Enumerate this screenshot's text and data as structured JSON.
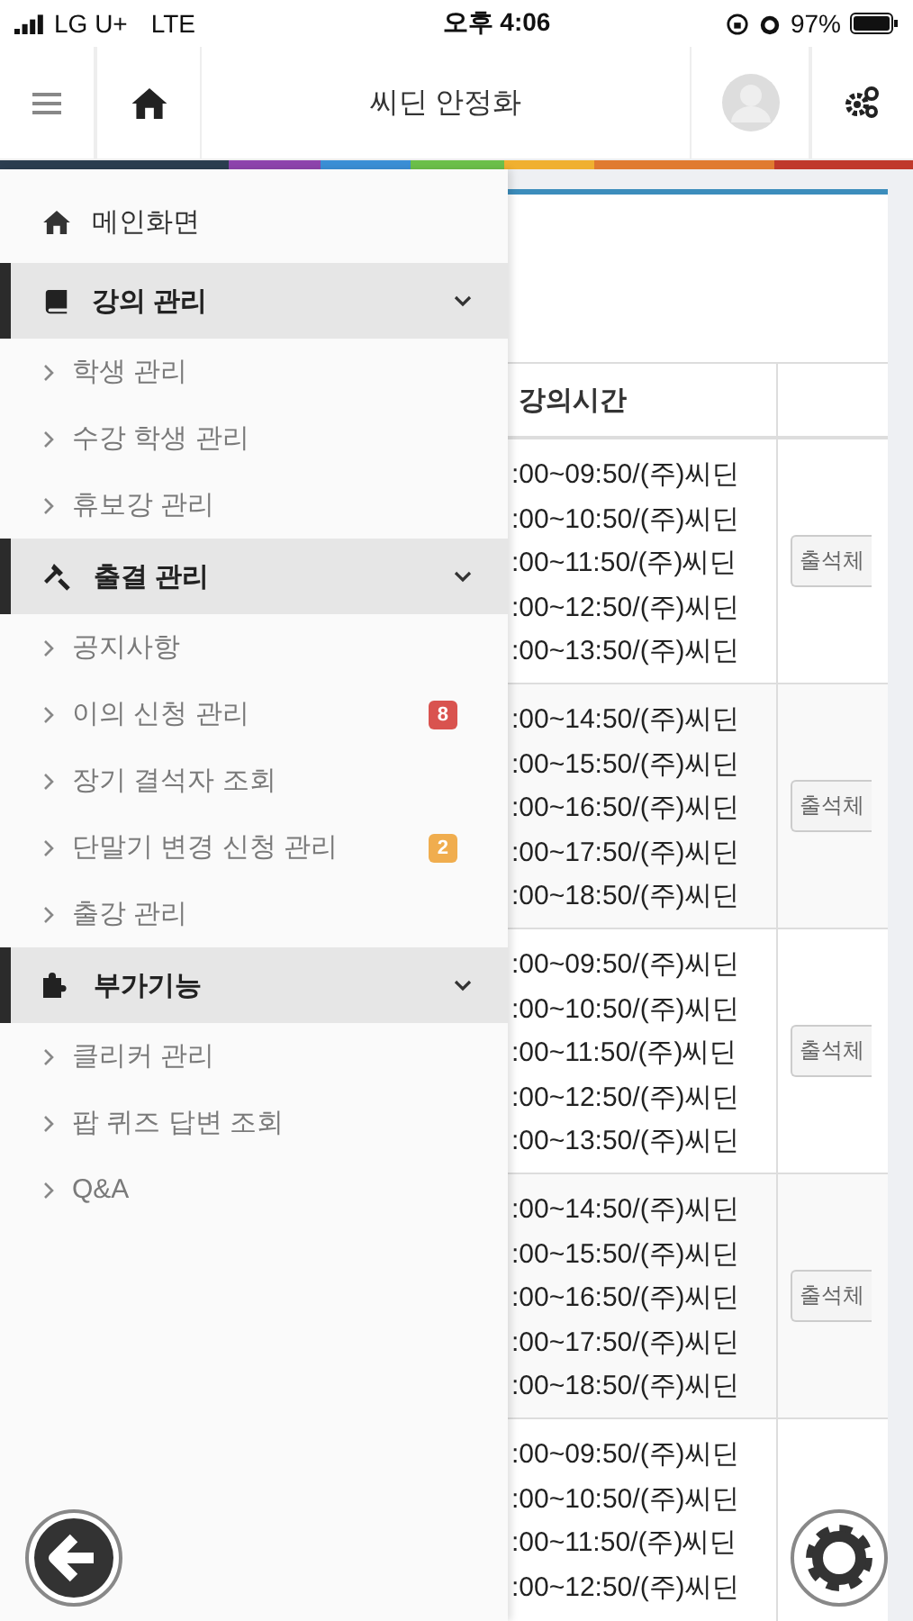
{
  "status_bar": {
    "carrier": "LG U+",
    "network": "LTE",
    "time": "오후 4:06",
    "battery": "97%"
  },
  "header": {
    "title": "씨딘 안정화"
  },
  "menu": [
    {
      "kind": "link",
      "label": "메인화면"
    },
    {
      "kind": "section",
      "label": "강의 관리",
      "expanded": true,
      "children": [
        {
          "label": "학생 관리"
        },
        {
          "label": "수강 학생 관리"
        },
        {
          "label": "휴보강 관리"
        }
      ]
    },
    {
      "kind": "section",
      "label": "출결 관리",
      "expanded": true,
      "children": [
        {
          "label": "공지사항"
        },
        {
          "label": "이의 신청 관리",
          "badge": "8",
          "color": "#d9534f"
        },
        {
          "label": "장기 결석자 조회"
        },
        {
          "label": "단말기 변경 신청 관리",
          "badge": "2",
          "color": "#f0ad4e"
        },
        {
          "label": "출강 관리"
        }
      ]
    },
    {
      "kind": "section",
      "label": "부가기능",
      "expanded": true,
      "children": [
        {
          "label": "클리커 관리"
        },
        {
          "label": "팝 퀴즈 답변 조회"
        },
        {
          "label": "Q&A"
        }
      ]
    }
  ],
  "table": {
    "columns": [
      "강의시간"
    ],
    "rows": [
      {
        "times": [
          ":00~09:50/(주)씨딘",
          ":00~10:50/(주)씨딘",
          ":00~11:50/(주)씨딘",
          ":00~12:50/(주)씨딘",
          ":00~13:50/(주)씨딘"
        ],
        "button": "출석체"
      },
      {
        "times": [
          ":00~14:50/(주)씨딘",
          ":00~15:50/(주)씨딘",
          ":00~16:50/(주)씨딘",
          ":00~17:50/(주)씨딘",
          ":00~18:50/(주)씨딘"
        ],
        "button": "출석체"
      },
      {
        "times": [
          ":00~09:50/(주)씨딘",
          ":00~10:50/(주)씨딘",
          ":00~11:50/(주)씨딘",
          ":00~12:50/(주)씨딘",
          ":00~13:50/(주)씨딘"
        ],
        "button": "출석체"
      },
      {
        "times": [
          ":00~14:50/(주)씨딘",
          ":00~15:50/(주)씨딘",
          ":00~16:50/(주)씨딘",
          ":00~17:50/(주)씨딘",
          ":00~18:50/(주)씨딘"
        ],
        "button": "출석체"
      },
      {
        "times": [
          ":00~09:50/(주)씨딘",
          ":00~10:50/(주)씨딘",
          ":00~11:50/(주)씨딘",
          ":00~12:50/(주)씨딘"
        ]
      }
    ]
  }
}
